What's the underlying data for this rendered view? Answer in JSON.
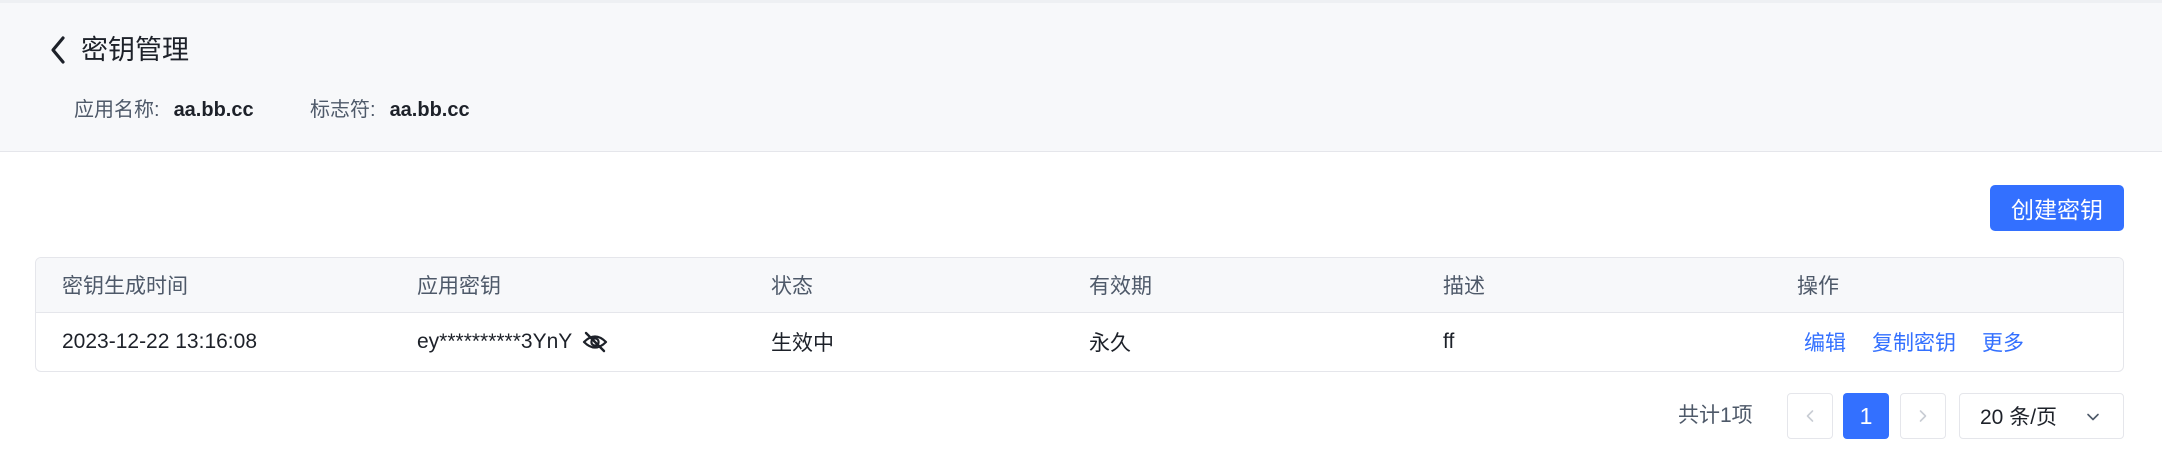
{
  "header": {
    "title": "密钥管理",
    "back_icon": "chevron-left-icon",
    "meta": [
      {
        "label": "应用名称",
        "value": "aa.bb.cc"
      },
      {
        "label": "标志符",
        "value": "aa.bb.cc"
      }
    ]
  },
  "toolbar": {
    "create_label": "创建密钥"
  },
  "table": {
    "columns": [
      "密钥生成时间",
      "应用密钥",
      "状态",
      "有效期",
      "描述",
      "操作"
    ],
    "rows": [
      {
        "created": "2023-12-22 13:16:08",
        "key": "ey**********3YnY",
        "key_icon": "eye-off-icon",
        "status": "生效中",
        "validity": "永久",
        "description": "ff",
        "actions": [
          "编辑",
          "复制密钥",
          "更多"
        ]
      }
    ]
  },
  "pagination": {
    "total_text": "共计1项",
    "current_page": "1",
    "page_size": "20 条/页"
  },
  "colors": {
    "primary": "#3370ff",
    "header_bg": "#f7f8fa",
    "border": "#e5e6eb"
  }
}
